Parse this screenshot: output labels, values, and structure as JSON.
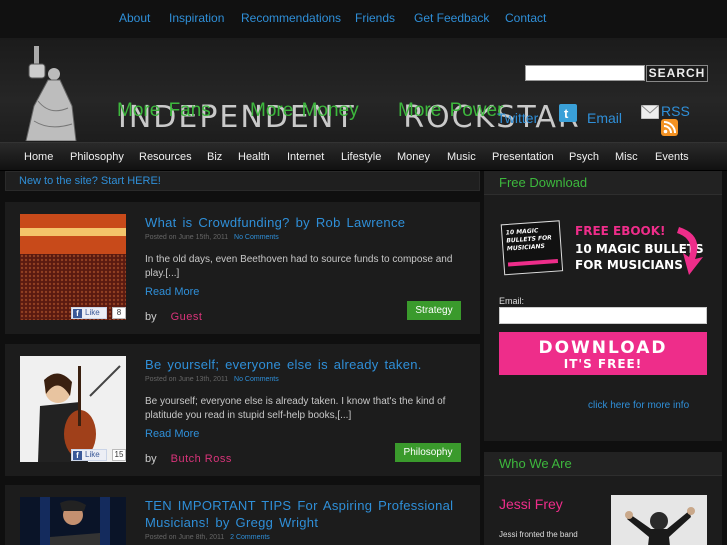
{
  "topnav": [
    "About",
    "Inspiration",
    "Recommendations",
    "Friends",
    "Get Feedback",
    "Contact"
  ],
  "header": {
    "brand_left": "INDEPENDENT",
    "brand_right": "ROCKSTAR",
    "taglines": [
      "More Fans",
      "More Money",
      "More Power"
    ],
    "search_button": "SEARCH",
    "search_placeholder": "",
    "social": {
      "twitter": "Twitter",
      "email": "Email",
      "rss": "RSS"
    }
  },
  "catnav": [
    "Home",
    "Philosophy",
    "Resources",
    "Biz",
    "Health",
    "Internet",
    "Lifestyle",
    "Money",
    "Music",
    "Presentation",
    "Psych",
    "Misc",
    "Events"
  ],
  "welcome": "New to the site? Start HERE!",
  "posts": [
    {
      "title": "What is Crowdfunding? by Rob Lawrence",
      "date": "Posted on June 15th, 2011",
      "comments": "No Comments",
      "excerpt": "In the old days, even Beethoven had to source funds to compose and play.[...]",
      "read_more": "Read More",
      "by": "by",
      "author": "Guest",
      "category": "Strategy",
      "fb_like": "Like",
      "fb_count": "8"
    },
    {
      "title": "Be yourself; everyone else is already taken.",
      "date": "Posted on June 13th, 2011",
      "comments": "No Comments",
      "excerpt": "Be yourself; everyone else is already taken. I know that's the kind of platitude you read in stupid self-help books,[...]",
      "read_more": "Read More",
      "by": "by",
      "author": "Butch Ross",
      "category": "Philosophy",
      "fb_like": "Like",
      "fb_count": "15"
    },
    {
      "title": "TEN IMPORTANT TIPS For Aspiring Professional Musicians! by Gregg Wright",
      "date": "Posted on June 8th, 2011",
      "comments": "2 Comments"
    }
  ],
  "sidebar": {
    "free_download": {
      "title": "Free Download",
      "ebook_line1": "FREE EBOOK!",
      "ebook_line2": "10 MAGIC BULLETS",
      "ebook_line3": "FOR MUSICIANS",
      "email_label": "Email:",
      "download_label": "DOWNLOAD",
      "download_sub": "IT'S FREE!",
      "more_info": "click here for more info"
    },
    "who_we_are": {
      "title": "Who We Are",
      "name": "Jessi Frey",
      "blurb": "Jessi fronted the band"
    }
  },
  "colors": {
    "link": "#2f8fd8",
    "green": "#3db83d",
    "pink": "#ee2d8a",
    "category_bg": "#3a9a2c"
  }
}
